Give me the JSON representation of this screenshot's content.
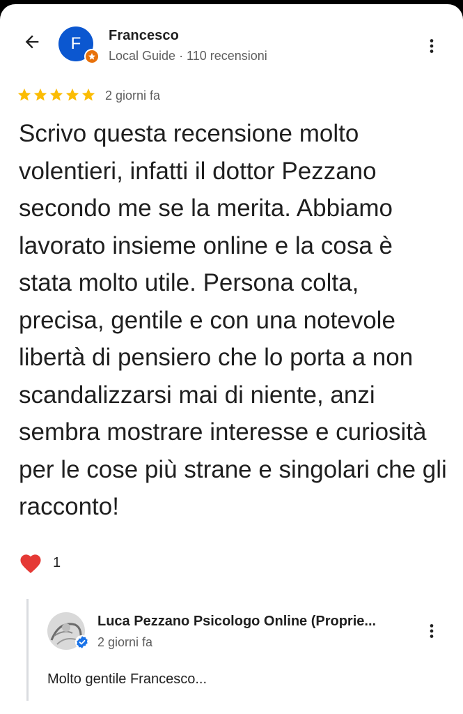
{
  "review": {
    "author": {
      "initial": "F",
      "name": "Francesco",
      "meta": "Local Guide · 110 recensioni"
    },
    "rating": 5,
    "time": "2 giorni fa",
    "text": "Scrivo questa recensione molto volentieri, infatti il dottor Pezzano secondo me se la merita. Abbiamo lavorato insieme online e la cosa è stata molto utile. Persona colta, precisa, gentile e con una notevole libertà di pensiero che lo porta a non scandalizzarsi mai di niente, anzi sembra mostrare interesse e curiosità per le cose più strane e singolari che gli racconto!",
    "reactions": {
      "icon": "heart-icon",
      "count": "1"
    }
  },
  "owner_reply": {
    "name": "Luca Pezzano Psicologo Online (Proprie...",
    "time": "2 giorni fa",
    "text": "Molto gentile Francesco..."
  },
  "colors": {
    "avatar": "#0b57d0",
    "star": "#fbbc04",
    "guide_badge": "#e8710a",
    "verified": "#1a73e8",
    "heart": "#e53935",
    "secondary_text": "#5e5e5e"
  }
}
